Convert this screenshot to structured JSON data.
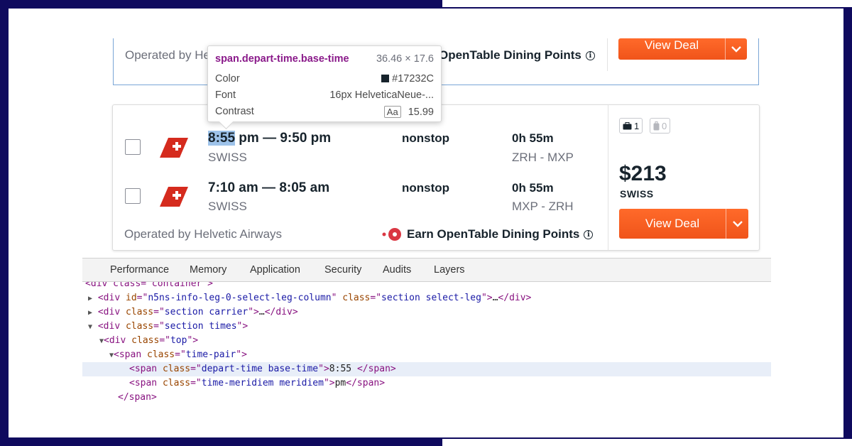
{
  "card1": {
    "operated_prefix": "Operated by He",
    "earn_partial": "OpenTable Dining Points",
    "view_deal": "View Deal"
  },
  "card2": {
    "legs": [
      {
        "depart_time": "8:55",
        "rest_time": " pm — 9:50 pm",
        "airline": "SWISS",
        "stops": "nonstop",
        "duration": "0h 55m",
        "route": "ZRH - MXP"
      },
      {
        "times": "7:10 am — 8:05 am",
        "airline": "SWISS",
        "stops": "nonstop",
        "duration": "0h 55m",
        "route": "MXP - ZRH"
      }
    ],
    "operated_by": "Operated by Helvetic Airways",
    "earn": "Earn OpenTable Dining Points",
    "bags": {
      "carry_on": "1",
      "checked": "0"
    },
    "price": "$213",
    "price_airline": "SWISS",
    "view_deal": "View Deal"
  },
  "tooltip": {
    "selector": "span.depart-time.base-time",
    "size": "36.46 × 17.6",
    "color_label": "Color",
    "color_value": "#17232C",
    "font_label": "Font",
    "font_value": "16px HelveticaNeue-...",
    "contrast_label": "Contrast",
    "contrast_aa": "Aa",
    "contrast_value": "15.99"
  },
  "devtools": {
    "tabs": [
      "Performance",
      "Memory",
      "Application",
      "Security",
      "Audits",
      "Layers"
    ],
    "code": {
      "l0": "<div class=\"container\">",
      "l1_attr_id": "n5ns-info-leg-0-select-leg-column",
      "l1_attr_class": "section select-leg",
      "l2_attr_class": "section carrier",
      "l3_attr_class": "section times",
      "l4_attr_class": "top",
      "l5_attr_class": "time-pair",
      "l6_attr_class": "depart-time base-time",
      "l6_text": "8:55 ",
      "l7_attr_class": "time-meridiem meridiem",
      "l7_text": "pm"
    }
  },
  "colors": {
    "accent_orange": "#f0541a",
    "swiss_red": "#d52b1e",
    "text_dark": "#17232c",
    "selection_blue": "#9ec3ea",
    "frame_navy": "#0f0a5e"
  }
}
